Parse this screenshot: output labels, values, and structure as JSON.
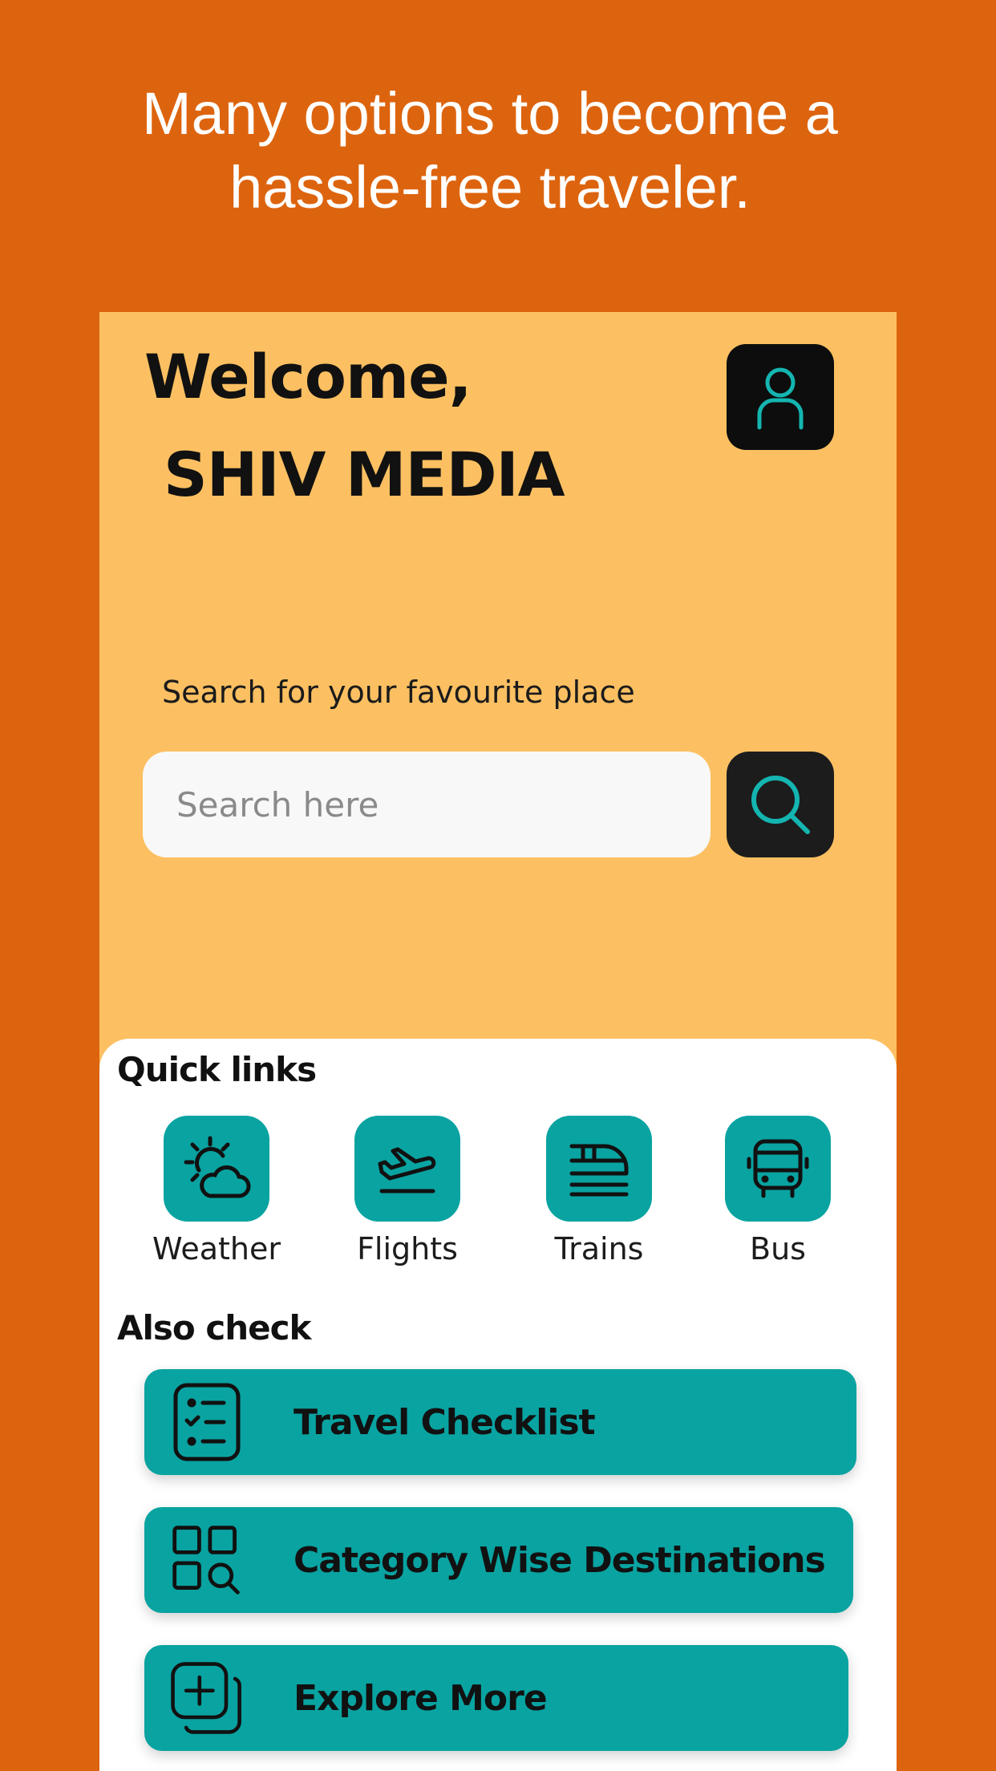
{
  "promo": {
    "line1": "Many options to become a",
    "line2": "hassle-free traveler."
  },
  "header": {
    "greeting": "Welcome,",
    "username": "SHIV MEDIA",
    "profile_icon": "user-icon"
  },
  "search": {
    "label": "Search for your favourite place",
    "placeholder": "Search here",
    "value": "",
    "button_icon": "search-icon"
  },
  "quick_links": {
    "title": "Quick links",
    "items": [
      {
        "label": "Weather",
        "icon": "weather-icon"
      },
      {
        "label": "Flights",
        "icon": "plane-icon"
      },
      {
        "label": "Trains",
        "icon": "train-icon"
      },
      {
        "label": "Bus",
        "icon": "bus-icon"
      }
    ]
  },
  "also_check": {
    "title": "Also check",
    "items": [
      {
        "label": "Travel Checklist",
        "icon": "checklist-icon"
      },
      {
        "label": "Category Wise Destinations",
        "icon": "category-search-icon"
      },
      {
        "label": "Explore More",
        "icon": "add-stack-icon"
      }
    ]
  },
  "colors": {
    "background": "#dd640e",
    "header_bg": "#fcc062",
    "accent": "#09a3a1",
    "dark_button": "#0d0d0d"
  }
}
